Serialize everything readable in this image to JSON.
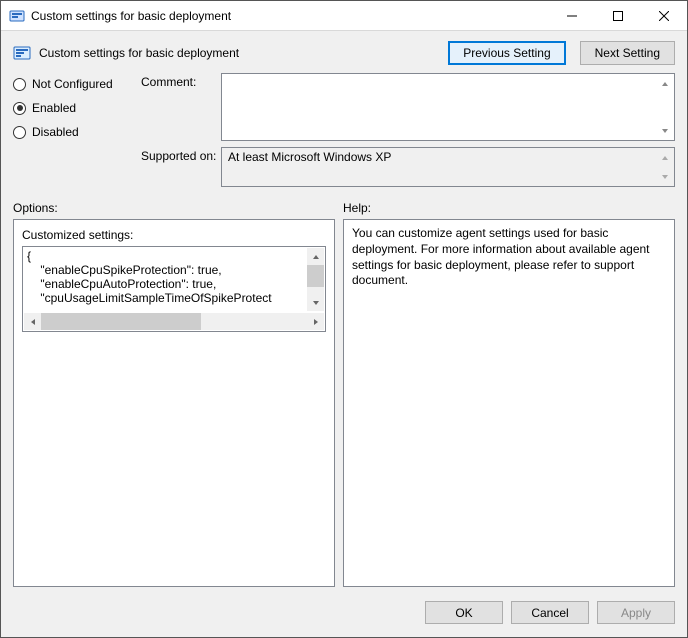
{
  "window": {
    "title": "Custom settings for basic deployment"
  },
  "header": {
    "caption": "Custom settings for basic deployment",
    "prev_btn": "Previous Setting",
    "next_btn": "Next Setting"
  },
  "radios": {
    "not_configured": "Not Configured",
    "enabled": "Enabled",
    "disabled": "Disabled",
    "selected": "enabled"
  },
  "form": {
    "comment_label": "Comment:",
    "comment_value": "",
    "supported_label": "Supported on:",
    "supported_value": "At least Microsoft Windows XP"
  },
  "section_labels": {
    "options": "Options:",
    "help": "Help:"
  },
  "options": {
    "customized_label": "Customized settings:",
    "code_text": "{\n    \"enableCpuSpikeProtection\": true,\n    \"enableCpuAutoProtection\": true,\n    \"cpuUsageLimitSampleTimeOfSpikeProtect"
  },
  "help": {
    "text": "You can customize agent settings used for basic deployment. For more information about available agent settings for basic deployment, please refer to support document."
  },
  "footer": {
    "ok": "OK",
    "cancel": "Cancel",
    "apply": "Apply"
  }
}
